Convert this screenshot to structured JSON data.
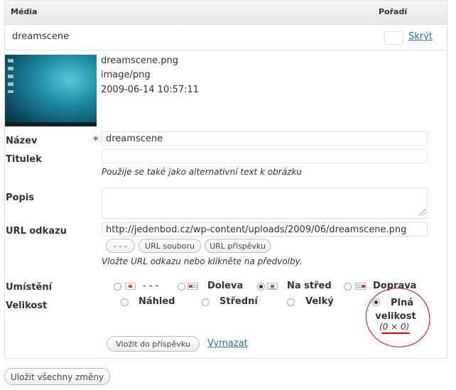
{
  "header": {
    "media_label": "Média",
    "order_label": "Pořadí"
  },
  "item": {
    "title": "dreamscene",
    "hide_label": "Skrýt"
  },
  "file": {
    "name": "dreamscene.png",
    "mime": "image/png",
    "date": "2009-06-14 10:57:11"
  },
  "fields": {
    "title_label": "Název",
    "title_value": "dreamscene",
    "caption_label": "Titulek",
    "caption_value": "",
    "caption_help": "Použije se také jako alternativní text k obrázku",
    "description_label": "Popis",
    "description_value": "",
    "url_label": "URL odkazu",
    "url_value": "http://jedenbod.cz/wp-content/uploads/2009/06/dreamscene.png",
    "url_help": "Vložte URL odkazu nebo klikněte na předvolby."
  },
  "url_buttons": {
    "none": "- - -",
    "file": "URL souboru",
    "post": "URL příspěvku"
  },
  "alignment": {
    "label": "Umístění",
    "options": [
      "- - -",
      "Doleva",
      "Na střed",
      "Doprava"
    ],
    "selected": "Na střed"
  },
  "size": {
    "label": "Velikost",
    "options": [
      "Náhled",
      "Střední",
      "Velký",
      "Plná velikost"
    ],
    "full_dims": "(0 × 0)",
    "selected": "Plná velikost"
  },
  "actions": {
    "insert": "Vložit do příspěvku",
    "delete": "Vymazat",
    "save_all": "Uložit všechny změny"
  },
  "colors": {
    "link": "#21759b",
    "required": "#d54e21",
    "annotation": "#e10000"
  }
}
